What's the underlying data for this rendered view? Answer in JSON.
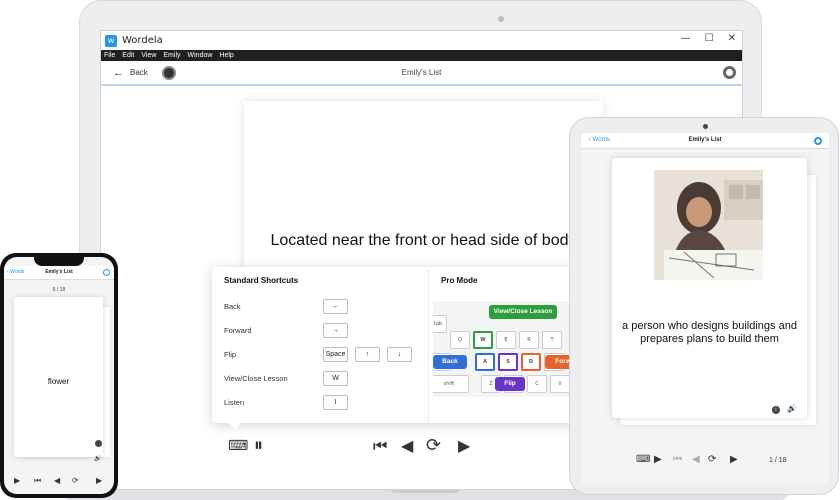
{
  "desktop": {
    "app_title": "Wordela",
    "window_controls": {
      "minimize": "—",
      "maximize": "☐",
      "close": "✕"
    },
    "menu": [
      "File",
      "Edit",
      "View",
      "Emily",
      "Window",
      "Help"
    ],
    "nav": {
      "back_label": "Back",
      "list_title": "Emily's List"
    },
    "card_text": "Located near the front or head side of body",
    "shortcuts": {
      "standard_title": "Standard Shortcuts",
      "pro_title": "Pro Mode",
      "rows": [
        {
          "label": "Back",
          "keys": [
            "←"
          ]
        },
        {
          "label": "Forward",
          "keys": [
            "→"
          ]
        },
        {
          "label": "Flip",
          "keys": [
            "Space",
            "↑",
            "↓"
          ]
        },
        {
          "label": "View/Close Lesson",
          "keys": [
            "W"
          ]
        },
        {
          "label": "Listen",
          "keys": [
            "I"
          ]
        }
      ],
      "keyboard": {
        "top_keys": [
          "Q",
          "W",
          "E",
          "R",
          "T"
        ],
        "mid_keys": [
          "A",
          "S",
          "D",
          "F"
        ],
        "bot_keys": [
          "Z",
          "X",
          "C",
          "V"
        ],
        "side_labels": [
          "tab",
          "caps",
          "shift"
        ],
        "tags": {
          "view_close": "View/Close Lesson",
          "back": "Back",
          "flip": "Flip",
          "forward": "Forw"
        },
        "colors": {
          "view_close": "#2e9e3c",
          "back": "#2f6fd6",
          "flip": "#6a34c9",
          "forward": "#e8622b"
        }
      }
    }
  },
  "tablet": {
    "back_label": "Words",
    "list_title": "Emily's List",
    "definition": "a person who designs buildings and prepares plans to build them",
    "count": "1 / 18"
  },
  "phone": {
    "back_label": "Words",
    "list_title": "Emily's List",
    "count": "6 / 18",
    "word": "flower"
  }
}
